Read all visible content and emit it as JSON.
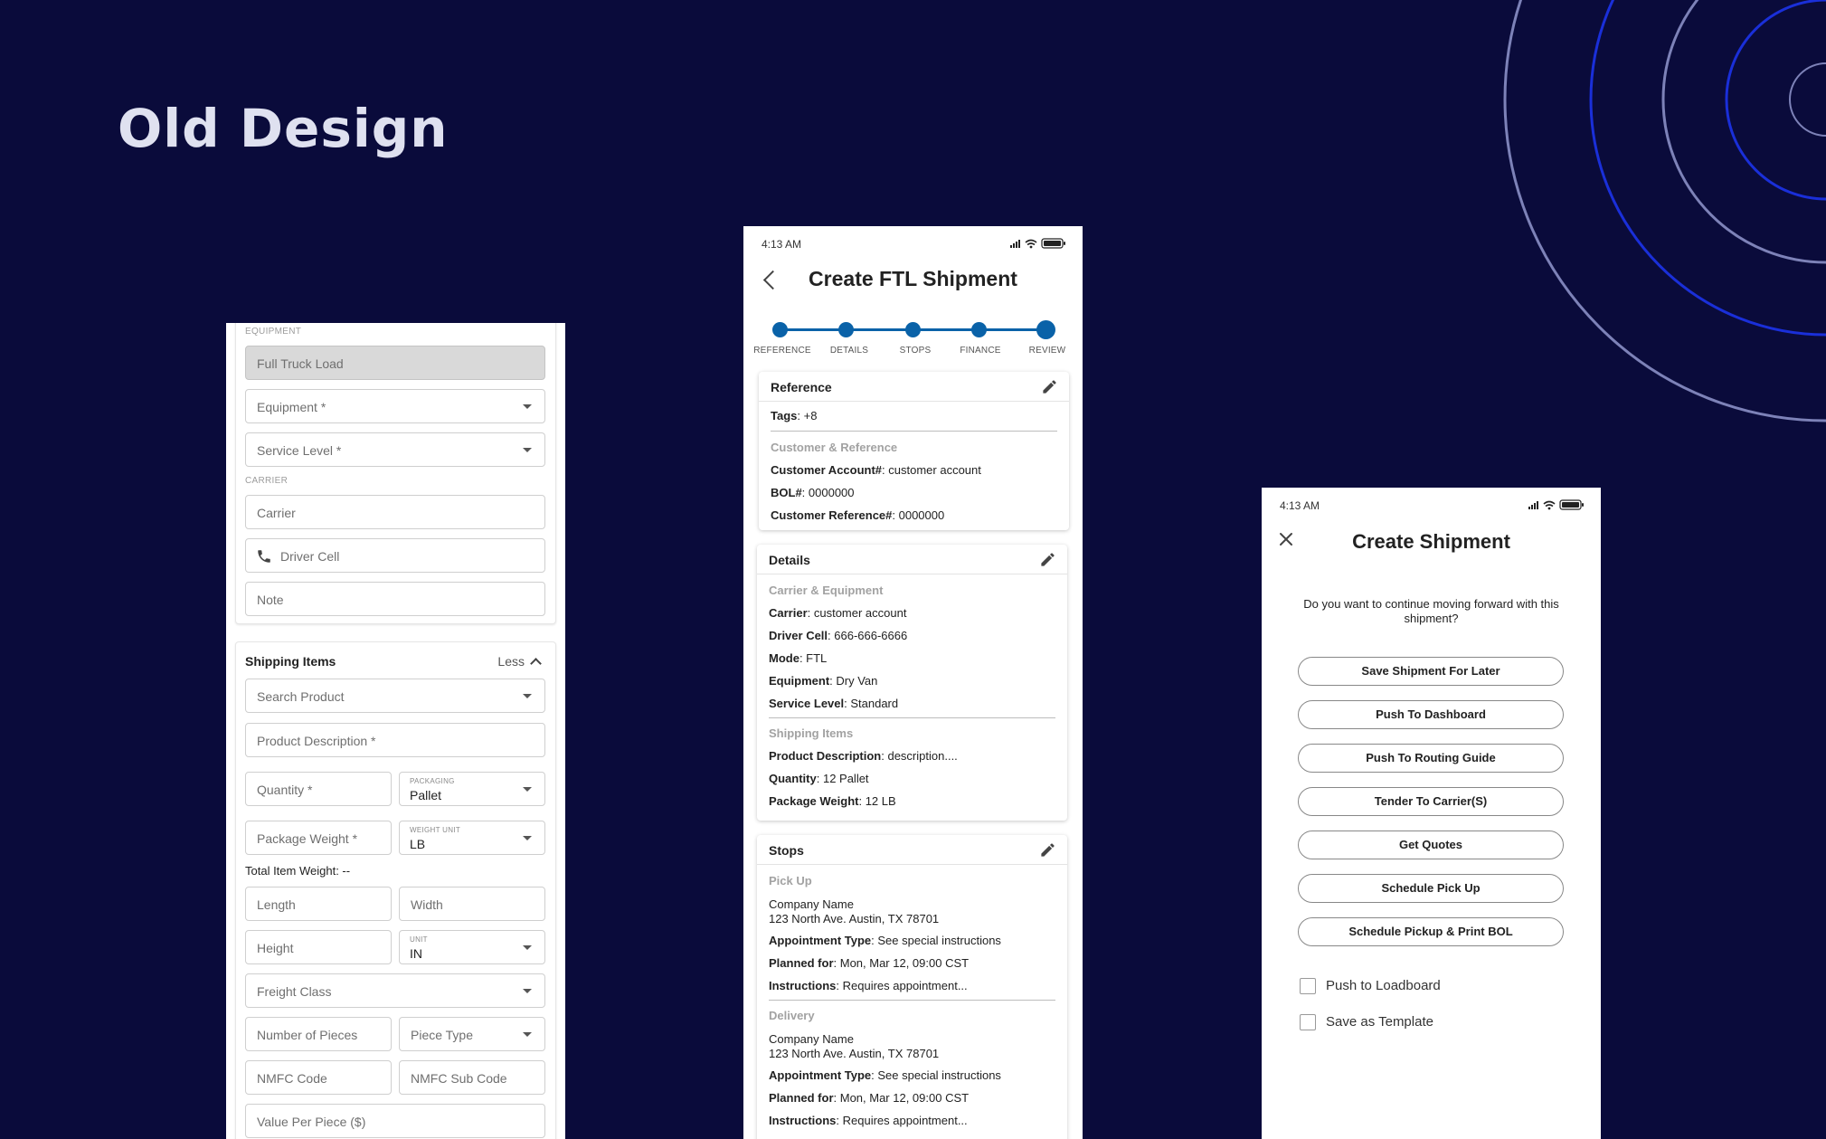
{
  "page": {
    "heading": "Old Design"
  },
  "status_bar": {
    "time": "4:13 AM"
  },
  "form_screen": {
    "equipment_section": "EQUIPMENT",
    "mode_value": "Full Truck Load",
    "equipment_placeholder": "Equipment *",
    "service_level_placeholder": "Service Level *",
    "carrier_section": "CARRIER",
    "carrier_placeholder": "Carrier",
    "driver_cell_placeholder": "Driver Cell",
    "note_placeholder": "Note",
    "shipping_items_title": "Shipping Items",
    "less_label": "Less",
    "search_product_placeholder": "Search Product",
    "product_description_placeholder": "Product Description *",
    "quantity_placeholder": "Quantity *",
    "packaging_label": "PACKAGING",
    "packaging_value": "Pallet",
    "package_weight_placeholder": "Package Weight *",
    "weight_unit_label": "WEIGHT UNIT",
    "weight_unit_value": "LB",
    "total_item_weight": "Total Item Weight: --",
    "length_placeholder": "Length",
    "width_placeholder": "Width",
    "height_placeholder": "Height",
    "unit_label": "UNIT",
    "unit_value": "IN",
    "freight_class_placeholder": "Freight Class",
    "number_of_pieces_placeholder": "Number of Pieces",
    "piece_type_placeholder": "Piece Type",
    "nmfc_code_placeholder": "NMFC Code",
    "nmfc_sub_code_placeholder": "NMFC Sub Code",
    "value_per_piece_placeholder": "Value Per Piece ($)"
  },
  "review_screen": {
    "title": "Create FTL Shipment",
    "steps": [
      "REFERENCE",
      "DETAILS",
      "STOPS",
      "FINANCE",
      "REVIEW"
    ],
    "reference": {
      "title": "Reference",
      "tags_key": "Tags",
      "tags_value": ": +8",
      "subheading": "Customer & Reference",
      "customer_account_key": "Customer Account#",
      "customer_account_value": ": customer account",
      "bol_key": "BOL#",
      "bol_value": ": 0000000",
      "customer_reference_key": "Customer Reference#",
      "customer_reference_value": ": 0000000"
    },
    "details": {
      "title": "Details",
      "subheading": "Carrier & Equipment",
      "carrier_key": "Carrier",
      "carrier_value": ": customer account",
      "driver_cell_key": "Driver Cell",
      "driver_cell_value": ": 666-666-6666",
      "mode_key": "Mode",
      "mode_value": ": FTL",
      "equipment_key": "Equipment",
      "equipment_value": ": Dry Van",
      "service_level_key": "Service Level",
      "service_level_value": ": Standard",
      "items_subheading": "Shipping Items",
      "product_description_key": "Product Description",
      "product_description_value": ": description....",
      "quantity_key": "Quantity",
      "quantity_value": ": 12 Pallet",
      "package_weight_key": "Package Weight",
      "package_weight_value": ": 12 LB"
    },
    "stops": {
      "title": "Stops",
      "pickup": {
        "subheading": "Pick Up",
        "company": "Company Name",
        "address": "123 North Ave. Austin, TX 78701",
        "appointment_key": "Appointment Type",
        "appointment_value": ": See special instructions",
        "planned_key": "Planned for",
        "planned_value": ": Mon, Mar 12, 09:00 CST",
        "instructions_key": "Instructions",
        "instructions_value": ": Requires appointment..."
      },
      "delivery": {
        "subheading": "Delivery",
        "company": "Company Name",
        "address": "123 North Ave. Austin, TX 78701",
        "appointment_key": "Appointment Type",
        "appointment_value": ": See special instructions",
        "planned_key": "Planned for",
        "planned_value": ": Mon, Mar 12, 09:00 CST",
        "instructions_key": "Instructions",
        "instructions_value": ": Requires appointment..."
      }
    }
  },
  "dialog_screen": {
    "title": "Create Shipment",
    "question": "Do you want to continue moving forward with this shipment?",
    "actions": [
      "Save Shipment For Later",
      "Push To Dashboard",
      "Push To Routing Guide",
      "Tender To Carrier(S)",
      "Get Quotes",
      "Schedule Pick Up",
      "Schedule Pickup & Print BOL"
    ],
    "push_to_loadboard": "Push to Loadboard",
    "save_as_template": "Save as Template"
  },
  "colors": {
    "background": "#0a0b3b",
    "accent_blue": "#0a62a8",
    "ring_blue": "#1a2fd9",
    "ring_grey": "#7d82b8"
  }
}
